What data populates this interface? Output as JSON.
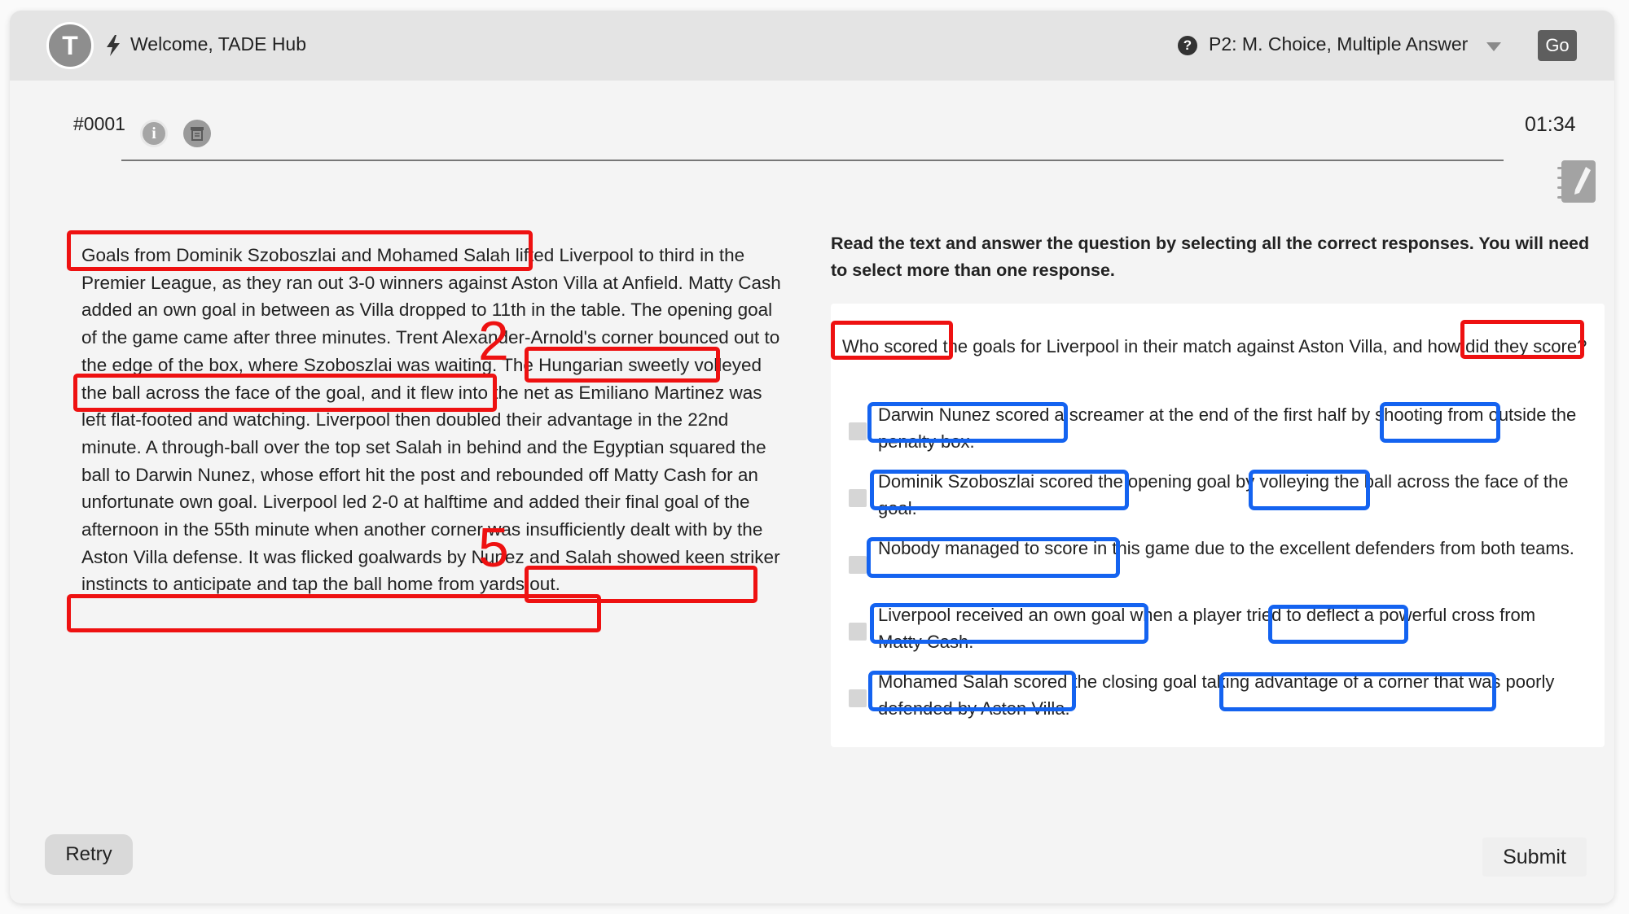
{
  "header": {
    "avatar_letter": "T",
    "welcome": "Welcome, TADE Hub",
    "question_type": "P2: M. Choice, Multiple Answer",
    "go_label": "Go",
    "icons": {
      "bolt": "bolt-icon",
      "help": "question-circle-icon",
      "caret": "caret-down-icon"
    }
  },
  "toolbar": {
    "question_number": "#0001",
    "timer": "01:34",
    "icons": {
      "info": "info-icon",
      "notes": "notes-icon",
      "notepad": "notepad-pencil-icon"
    }
  },
  "passage": {
    "text": "Goals from Dominik Szoboszlai and Mohamed Salah lifted Liverpool to third in the Premier League, as they ran out 3-0 winners against Aston Villa at Anfield. Matty Cash added an own goal in between as Villa dropped to 11th in the table. The opening goal of the game came after three minutes. Trent Alexander-Arnold's corner bounced out to the edge of the box, where Szoboszlai was waiting. The Hungarian sweetly volleyed the ball across the face of the goal, and it flew into the net as Emiliano Martinez was left flat-footed and watching. Liverpool then doubled their advantage in the 22nd minute. A through-ball over the top set Salah in behind and the Egyptian squared the ball to Darwin Nunez, whose effort hit the post and rebounded off Matty Cash for an unfortunate own goal. Liverpool led 2-0 at halftime and added their final goal of the afternoon in the 55th minute when another corner was insufficiently dealt with by the Aston Villa defense. It was flicked goalwards by Nunez and Salah showed keen striker instincts to anticipate and tap the ball home from yards out."
  },
  "instructions": "Read the text and answer the question by selecting all the correct responses. You will need to select more than one response.",
  "question": "Who scored the goals for Liverpool in their match against Aston Villa, and how did they score?",
  "options": [
    {
      "text": "Darwin Nunez scored a screamer at the end of the first half by shooting from outside the penalty box.",
      "checked": false
    },
    {
      "text": "Dominik Szoboszlai scored the opening goal by volleying the ball across the face of the goal.",
      "checked": false
    },
    {
      "text": "Nobody managed to score in this game due to the excellent defenders from both teams.",
      "checked": false
    },
    {
      "text": "Liverpool received an own goal when a player tried to deflect a powerful cross from Matty Cash.",
      "checked": false
    },
    {
      "text": "Mohamed Salah scored the closing goal taking advantage of a corner that was poorly defended by Aston Villa.",
      "checked": false
    }
  ],
  "annotations": {
    "passage_numbers": [
      "2",
      "5"
    ],
    "highlight_colors": {
      "passage_and_question": "#ee1111",
      "options": "#1463f0"
    }
  },
  "footer": {
    "retry_label": "Retry",
    "submit_label": "Submit"
  }
}
